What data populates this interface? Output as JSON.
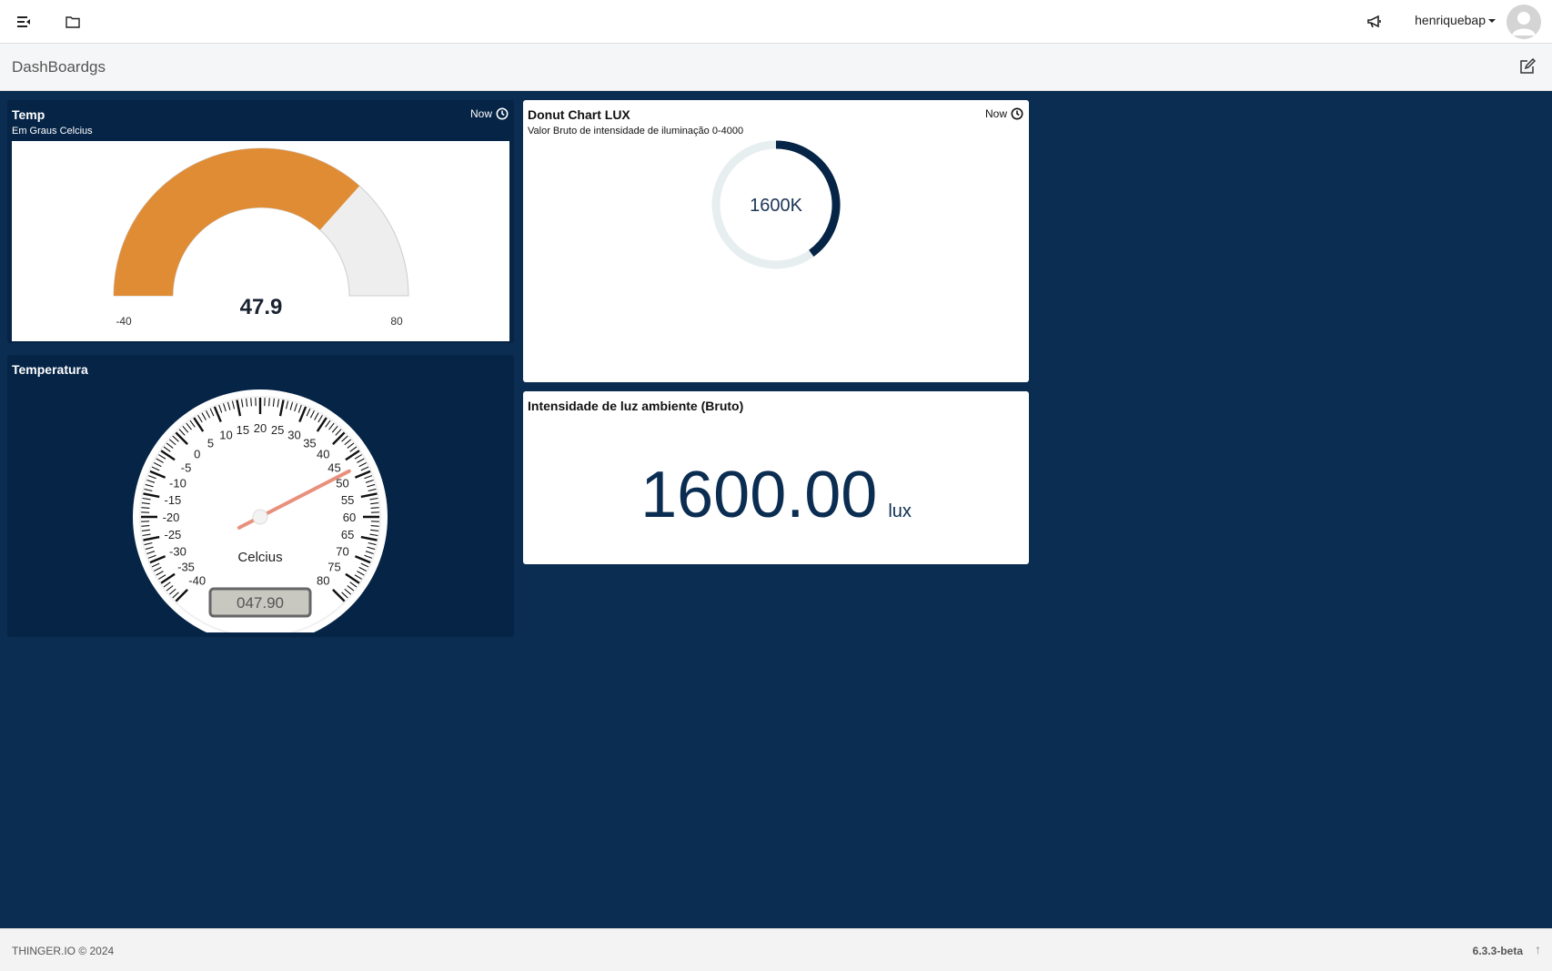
{
  "navbar": {
    "menu_icon": "menu-collapse-icon",
    "folder_icon": "folder-icon",
    "announce_icon": "megaphone-icon",
    "username": "henriquebap"
  },
  "header": {
    "title": "DashBoardgs",
    "edit_icon": "edit-icon"
  },
  "widgets": {
    "temp": {
      "title": "Temp",
      "subtitle": "Em Graus Celcius",
      "now_label": "Now",
      "value": "47.9",
      "min": "-40",
      "max": "80",
      "fill_color": "#e08c35",
      "track_color": "#eeeeee"
    },
    "donut": {
      "title": "Donut Chart LUX",
      "subtitle": "Valor Bruto de intensidade de iluminação 0-4000",
      "now_label": "Now",
      "center_label": "1600K",
      "fill_color": "#052446",
      "track_color": "#e6eef0"
    },
    "temperatura": {
      "title": "Temperatura",
      "unit_label": "Celcius",
      "readout": "047.90",
      "ticks": [
        "-40",
        "-35",
        "-30",
        "-25",
        "-20",
        "-15",
        "-10",
        "-5",
        "0",
        "5",
        "10",
        "15",
        "20",
        "25",
        "30",
        "35",
        "40",
        "45",
        "50",
        "55",
        "60",
        "65",
        "70",
        "75",
        "80"
      ]
    },
    "lux": {
      "title": "Intensidade de luz ambiente (Bruto)",
      "value": "1600.00",
      "unit": "lux"
    }
  },
  "chart_data": [
    {
      "type": "gauge",
      "title": "Temp",
      "value": 47.9,
      "min": -40,
      "max": 80
    },
    {
      "type": "donut",
      "title": "Donut Chart LUX",
      "value": 1600,
      "min": 0,
      "max": 4000
    },
    {
      "type": "gauge",
      "title": "Temperatura",
      "value": 47.9,
      "min": -40,
      "max": 80
    }
  ],
  "footer": {
    "copyright": "THINGER.IO © 2024",
    "version": "6.3.3-beta"
  }
}
